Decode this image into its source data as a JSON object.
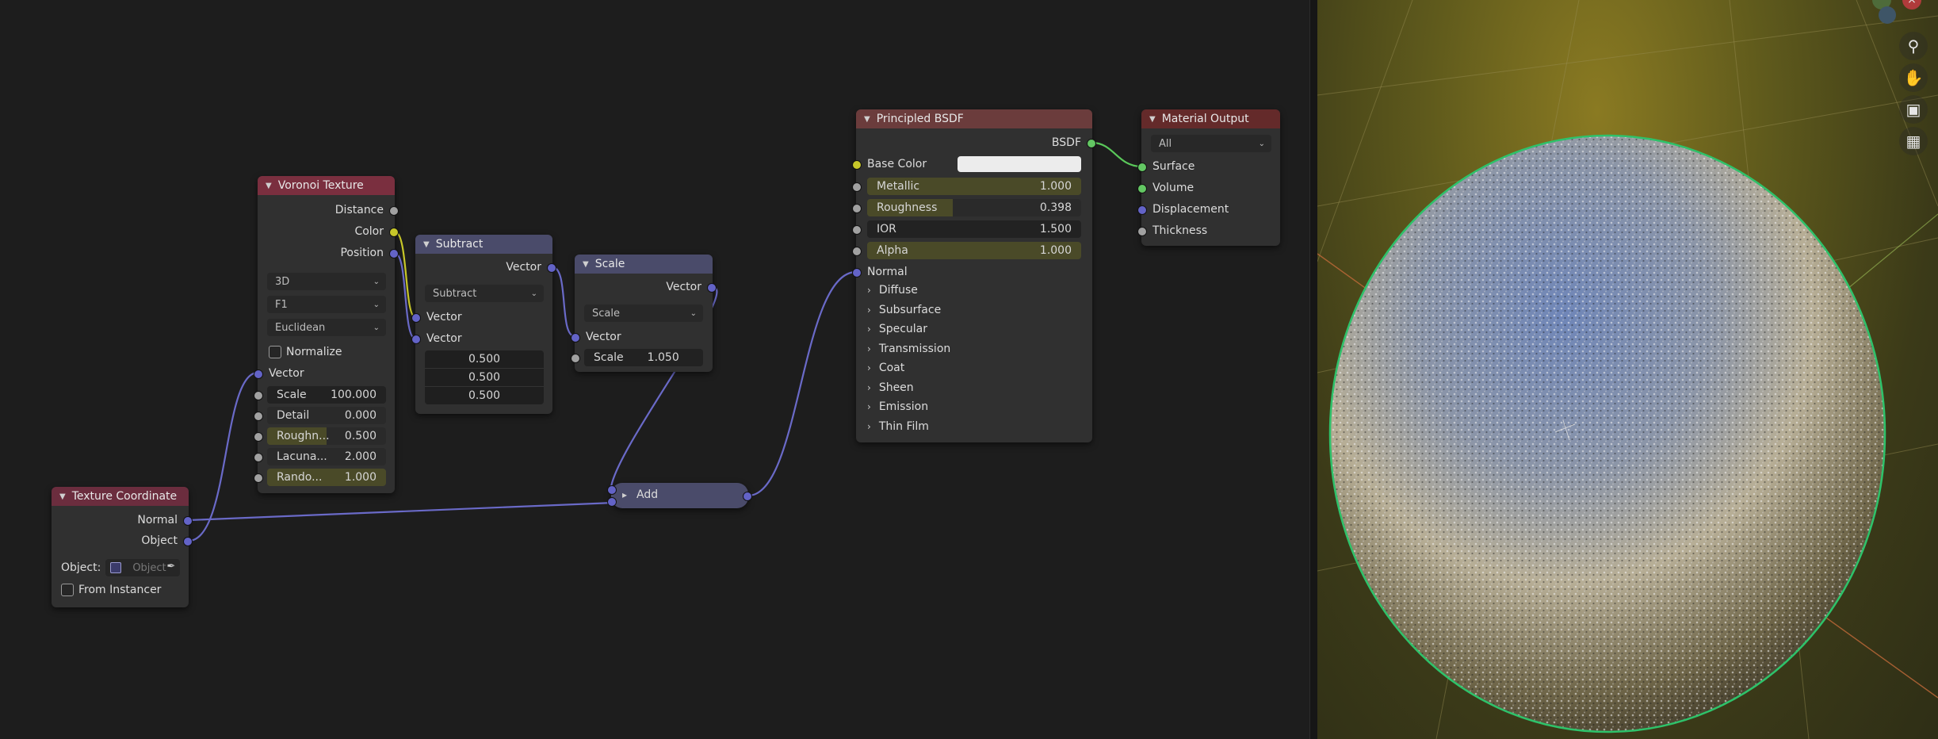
{
  "nodes": {
    "voronoi": {
      "title": "Voronoi Texture",
      "outputs": [
        "Distance",
        "Color",
        "Position"
      ],
      "dropdowns": [
        "3D",
        "F1",
        "Euclidean"
      ],
      "normalize_label": "Normalize",
      "vector_label": "Vector",
      "fields": [
        {
          "label": "Scale",
          "value": "100.000"
        },
        {
          "label": "Detail",
          "value": "0.000"
        },
        {
          "label": "Roughn...",
          "value": "0.500"
        },
        {
          "label": "Lacuna...",
          "value": "2.000"
        },
        {
          "label": "Rando...",
          "value": "1.000"
        }
      ]
    },
    "subtract": {
      "title": "Subtract",
      "output": "Vector",
      "operation": "Subtract",
      "inputs": [
        "Vector",
        "Vector"
      ],
      "values": [
        "0.500",
        "0.500",
        "0.500"
      ]
    },
    "scale": {
      "title": "Scale",
      "output": "Vector",
      "operation": "Scale",
      "input": "Vector",
      "scale_label": "Scale",
      "scale_value": "1.050"
    },
    "add": {
      "title": "Add"
    },
    "texcoord": {
      "title": "Texture Coordinate",
      "outputs": [
        "Normal",
        "Object"
      ],
      "object_label": "Object:",
      "object_placeholder": "Object",
      "from_instancer": "From Instancer"
    },
    "bsdf": {
      "title": "Principled BSDF",
      "output": "BSDF",
      "base_color_label": "Base Color",
      "fields": [
        {
          "label": "Metallic",
          "value": "1.000"
        },
        {
          "label": "Roughness",
          "value": "0.398"
        },
        {
          "label": "IOR",
          "value": "1.500"
        },
        {
          "label": "Alpha",
          "value": "1.000"
        }
      ],
      "normal_label": "Normal",
      "panels": [
        "Diffuse",
        "Subsurface",
        "Specular",
        "Transmission",
        "Coat",
        "Sheen",
        "Emission",
        "Thin Film"
      ]
    },
    "output": {
      "title": "Material Output",
      "target": "All",
      "inputs": [
        "Surface",
        "Volume",
        "Displacement",
        "Thickness"
      ]
    }
  },
  "viewport": {
    "tools": [
      "zoom-icon",
      "hand-icon",
      "camera-icon",
      "grid-icon"
    ]
  },
  "colors": {
    "socket_float": "#a1a1a1",
    "socket_color": "#c7c729",
    "socket_vector": "#6363c7",
    "socket_shader": "#63c763",
    "wire_vector": "#6a6ac8",
    "wire_color": "#c7c729",
    "wire_shader": "#5ac85a",
    "selection_outline": "#2ec26a"
  }
}
